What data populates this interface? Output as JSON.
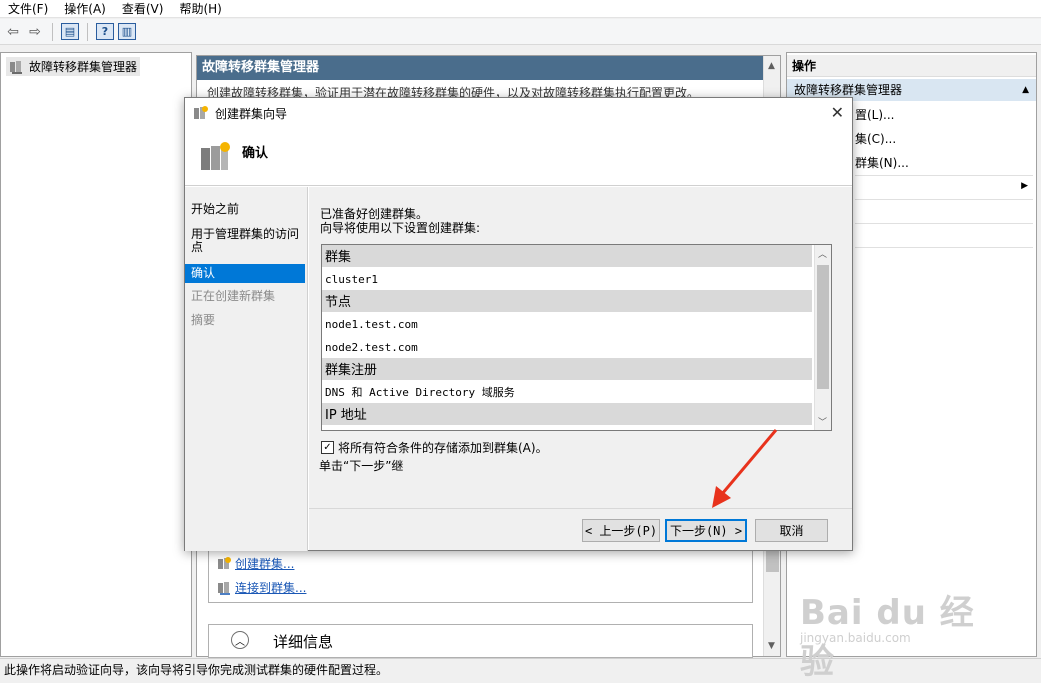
{
  "menu": {
    "file": "文件(F)",
    "action": "操作(A)",
    "view": "查看(V)",
    "help": "帮助(H)"
  },
  "toolbar": {
    "icons": [
      "back-arrow-icon",
      "forward-arrow-icon",
      "show-hide-console-tree-icon",
      "help-icon",
      "show-hide-action-pane-icon"
    ]
  },
  "tree": {
    "root_label": "故障转移群集管理器"
  },
  "center": {
    "header": "故障转移群集管理器",
    "subtitle": "创建故障转移群集，验证用于潜在故障转移群集的硬件，以及对故障转移群集执行配置更改。",
    "links": {
      "create_cluster": "创建群集...",
      "connect_cluster": "连接到群集..."
    },
    "details": "详细信息"
  },
  "actions": {
    "header": "操作",
    "section": "故障转移群集管理器",
    "items": [
      "置(L)...",
      "集(C)...",
      "群集(N)..."
    ]
  },
  "status_bar": "此操作将启动验证向导，该向导将引导你完成测试群集的硬件配置过程。",
  "dialog": {
    "title": "创建群集向导",
    "heading": "确认",
    "nav": {
      "before": "开始之前",
      "access_point": "用于管理群集的访问点",
      "confirm": "确认",
      "creating": "正在创建新群集",
      "summary": "摘要"
    },
    "intro_line1": "已准备好创建群集。",
    "intro_line2": "向导将使用以下设置创建群集:",
    "list": {
      "sec_cluster": "群集",
      "cluster_name": "cluster1",
      "sec_nodes": "节点",
      "node1": "node1.test.com",
      "node2": "node2.test.com",
      "sec_registration": "群集注册",
      "registration": "DNS 和 Active Directory 域服务",
      "sec_ip": "IP 地址"
    },
    "add_storage": "将所有符合条件的存储添加到群集(A)。",
    "hint": "单击“下一步”继",
    "buttons": {
      "prev": "< 上一步(P)",
      "next": "下一步(N) >",
      "cancel": "取消"
    }
  },
  "watermark": {
    "brand": "Bai du 经验",
    "url": "jingyan.baidu.com"
  },
  "colors": {
    "accent": "#0078d7",
    "header_bar": "#4a6d8c",
    "annotation_arrow": "#e8321c"
  }
}
